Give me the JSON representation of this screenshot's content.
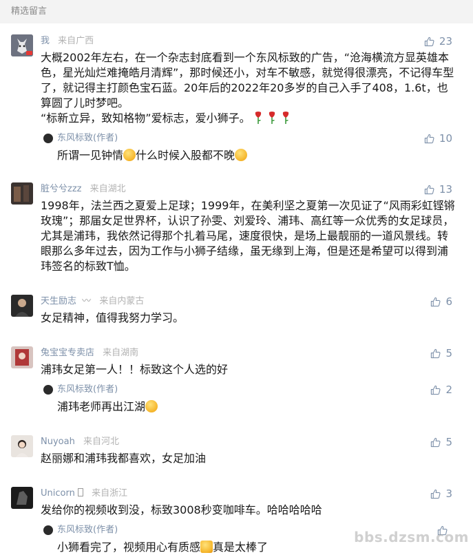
{
  "header": {
    "title": "精选留言"
  },
  "comments": [
    {
      "name": "我",
      "region": "来自广西",
      "likes": "23",
      "text_lines": [
        "大概2002年左右，在一个杂志封底看到一个东风标致的广告，“沧海横流方显英雄本色，星光灿烂难掩皓月清辉”，那时候还小，对车不敏感，就觉得很漂亮，不记得车型了，就记得主打颜色宝石蓝。20年后的2022年20多岁的自己入手了408，1.6t，也算圆了儿时梦吧。",
        "“标新立异，致知格物”爱标志，爱小狮子。"
      ],
      "reply": {
        "name": "东风标致(作者)",
        "likes": "10",
        "text_a": "所谓一见钟情",
        "text_b": "什么时候入股都不晚"
      }
    },
    {
      "name": "脏兮兮zzz",
      "region": "来自湖北",
      "likes": "13",
      "text": "1998年，法兰西之夏爱上足球；1999年，在美利坚之夏第一次见证了“风雨彩虹铿锵玫瑰”；那届女足世界杯，认识了孙雯、刘爱玲、浦玮、高红等一众优秀的女足球员，尤其是浦玮，我依然记得那个扎着马尾，速度很快，是场上最靓丽的一道风景线。转眼那么多年过去，因为工作与小狮子结缘，虽无缘到上海，但是还是希望可以得到浦玮签名的标致T恤。"
    },
    {
      "name": "天生励志",
      "region": "来自内蒙古",
      "likes": "6",
      "text": "女足精神，值得我努力学习。"
    },
    {
      "name": "兔宝宝专卖店",
      "region": "来自湖南",
      "likes": "5",
      "text": "浦玮女足第一人！！标致这个人选的好",
      "reply": {
        "name": "东风标致(作者)",
        "likes": "2",
        "text_a": "浦玮老师再出江湖"
      }
    },
    {
      "name": "Nuyoah",
      "region": "来自河北",
      "likes": "5",
      "text": "赵丽娜和浦玮我都喜欢，女足加油"
    },
    {
      "name": "Unicorn",
      "region": "来自浙江",
      "likes": "3",
      "text": "发给你的视频收到没，标致3008秒变咖啡车。哈哈哈哈哈",
      "reply": {
        "name": "东风标致(作者)",
        "text_a": "小狮看完了，视频用心有质感",
        "text_b": "真是太棒了"
      }
    }
  ],
  "watermark": "bbs.dzsm.com"
}
